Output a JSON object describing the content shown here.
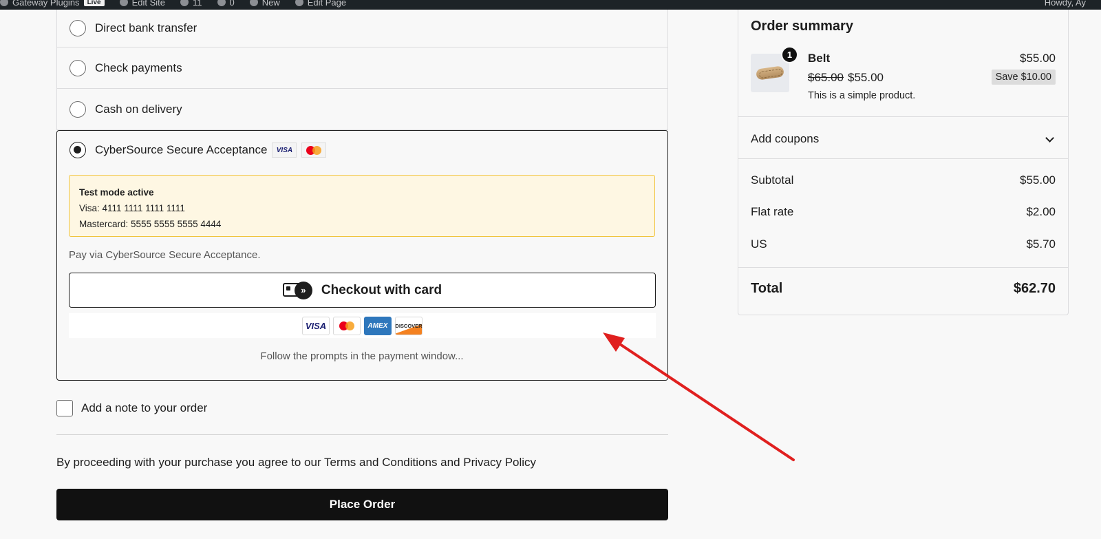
{
  "admin_bar": {
    "items": [
      "Gateway Plugins",
      "Edit Site",
      "11",
      "0",
      "New",
      "Edit Page"
    ],
    "badge": "Live",
    "right": "Howdy, Ay"
  },
  "payment_methods": {
    "options": [
      {
        "label": "Direct bank transfer",
        "selected": false
      },
      {
        "label": "Check payments",
        "selected": false
      },
      {
        "label": "Cash on delivery",
        "selected": false
      }
    ],
    "active": {
      "label": "CyberSource Secure Acceptance",
      "selected": true,
      "card_icons": [
        "visa-icon",
        "mastercard-icon"
      ],
      "visa_text": "VISA"
    },
    "notice": {
      "title": "Test mode active",
      "visa": "Visa: 4111 1111 1111 1111",
      "mastercard": "Mastercard: 5555 5555 5555 4444"
    },
    "description": "Pay via CyberSource Secure Acceptance.",
    "checkout_button": "Checkout with card",
    "logos": {
      "visa": "VISA",
      "amex": "AMEX",
      "discover": "DISCOVER"
    },
    "follow_text": "Follow the prompts in the payment window..."
  },
  "order_note": {
    "label": "Add a note to your order",
    "checked": false
  },
  "terms": "By proceeding with your purchase you agree to our Terms and Conditions and Privacy Policy",
  "place_order": "Place Order",
  "summary": {
    "title": "Order summary",
    "item": {
      "name": "Belt",
      "quantity": "1",
      "price": "$55.00",
      "regular_price": "$65.00",
      "sale_price": "$55.00",
      "save": "Save $10.00",
      "description": "This is a simple product."
    },
    "coupons_label": "Add coupons",
    "lines": [
      {
        "label": "Subtotal",
        "value": "$55.00"
      },
      {
        "label": "Flat rate",
        "value": "$2.00"
      },
      {
        "label": "US",
        "value": "$5.70"
      }
    ],
    "total": {
      "label": "Total",
      "value": "$62.70"
    }
  },
  "colors": {
    "annotation_arrow": "#e0201f",
    "notice_bg": "#fef7e3",
    "notice_border": "#f0c33c",
    "button_dark": "#111111"
  }
}
